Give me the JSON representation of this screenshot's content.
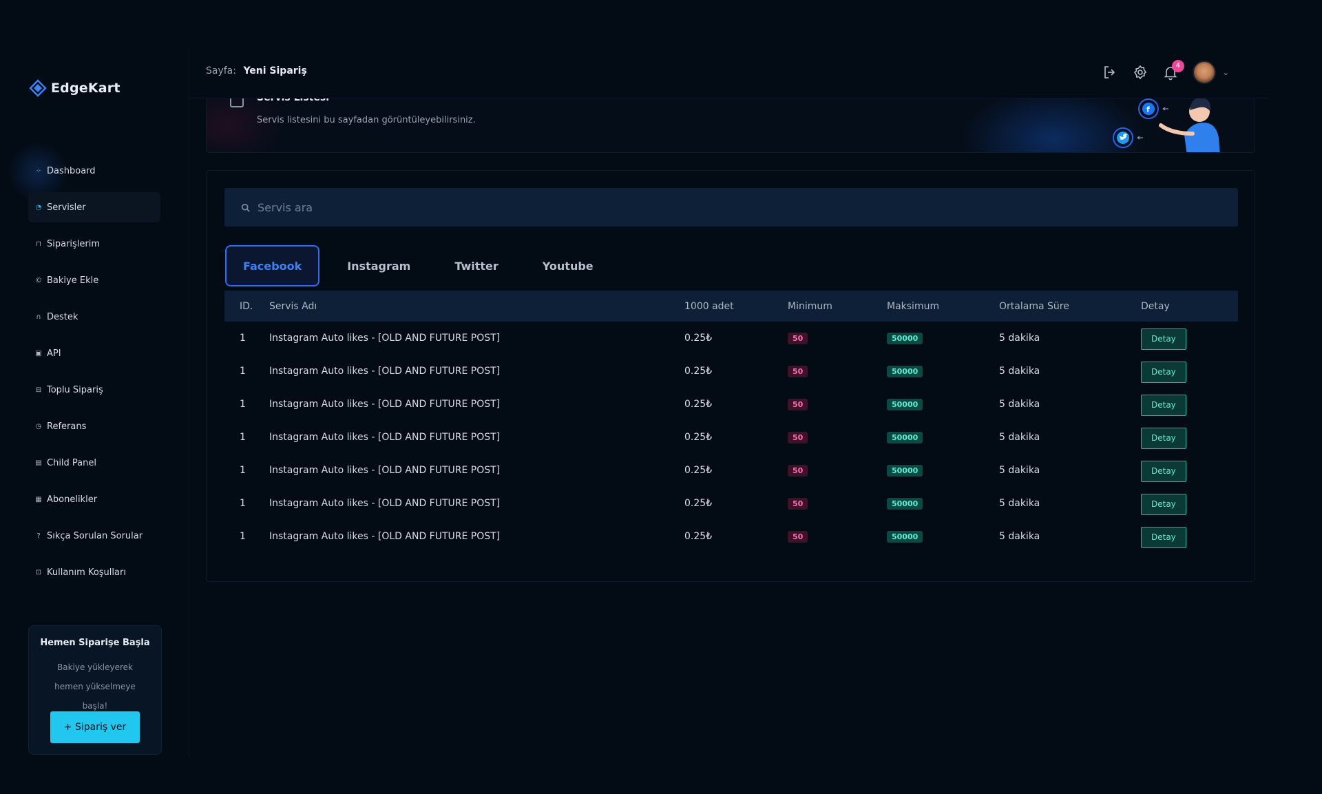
{
  "brand": {
    "name": "EdgeKart",
    "color": "#3b82f6"
  },
  "sidebar": {
    "items": [
      {
        "label": "Dashboard",
        "icon": "grid-icon"
      },
      {
        "label": "Servisler",
        "icon": "gauge-icon",
        "active": true
      },
      {
        "label": "Siparişlerim",
        "icon": "lock-icon"
      },
      {
        "label": "Bakiye Ekle",
        "icon": "coin-icon"
      },
      {
        "label": "Destek",
        "icon": "headset-icon"
      },
      {
        "label": "API",
        "icon": "image-icon"
      },
      {
        "label": "Toplu Sipariş",
        "icon": "basket-icon"
      },
      {
        "label": "Referans",
        "icon": "clock-icon"
      },
      {
        "label": "Child Panel",
        "icon": "panel-icon"
      },
      {
        "label": "Abonelikler",
        "icon": "receipt-icon"
      },
      {
        "label": "Sıkça Sorulan Sorular",
        "icon": "question-icon"
      },
      {
        "label": "Kullanım Koşulları",
        "icon": "document-icon"
      }
    ],
    "promo": {
      "title": "Hemen Siparişe Başla",
      "text": "Bakiye yükleyerek hemen yükselmeye başla!",
      "button": "+ Sipariş ver"
    }
  },
  "header": {
    "breadcrumb_label": "Sayfa:",
    "page_title": "Yeni Sipariş",
    "notification_count": "4"
  },
  "banner": {
    "title": "Servis Listesi",
    "subtitle": "Servis listesini bu sayfadan görüntüleyebilirsiniz."
  },
  "search": {
    "placeholder": "Servis ara"
  },
  "tabs": [
    {
      "label": "Facebook",
      "active": true
    },
    {
      "label": "Instagram"
    },
    {
      "label": "Twitter"
    },
    {
      "label": "Youtube"
    }
  ],
  "table": {
    "headers": [
      "ID.",
      "Servis Adı",
      "1000 adet",
      "Minimum",
      "Maksimum",
      "Ortalama Süre",
      "Detay"
    ],
    "rows": [
      {
        "id": "1",
        "name": "Instagram Auto likes - [OLD AND FUTURE POST]",
        "price": "0.25₺",
        "min": "50",
        "max": "50000",
        "time": "5 dakika",
        "action": "Detay"
      },
      {
        "id": "1",
        "name": "Instagram Auto likes - [OLD AND FUTURE POST]",
        "price": "0.25₺",
        "min": "50",
        "max": "50000",
        "time": "5 dakika",
        "action": "Detay"
      },
      {
        "id": "1",
        "name": "Instagram Auto likes - [OLD AND FUTURE POST]",
        "price": "0.25₺",
        "min": "50",
        "max": "50000",
        "time": "5 dakika",
        "action": "Detay"
      },
      {
        "id": "1",
        "name": "Instagram Auto likes - [OLD AND FUTURE POST]",
        "price": "0.25₺",
        "min": "50",
        "max": "50000",
        "time": "5 dakika",
        "action": "Detay"
      },
      {
        "id": "1",
        "name": "Instagram Auto likes - [OLD AND FUTURE POST]",
        "price": "0.25₺",
        "min": "50",
        "max": "50000",
        "time": "5 dakika",
        "action": "Detay"
      },
      {
        "id": "1",
        "name": "Instagram Auto likes - [OLD AND FUTURE POST]",
        "price": "0.25₺",
        "min": "50",
        "max": "50000",
        "time": "5 dakika",
        "action": "Detay"
      },
      {
        "id": "1",
        "name": "Instagram Auto likes - [OLD AND FUTURE POST]",
        "price": "0.25₺",
        "min": "50",
        "max": "50000",
        "time": "5 dakika",
        "action": "Detay"
      }
    ]
  }
}
